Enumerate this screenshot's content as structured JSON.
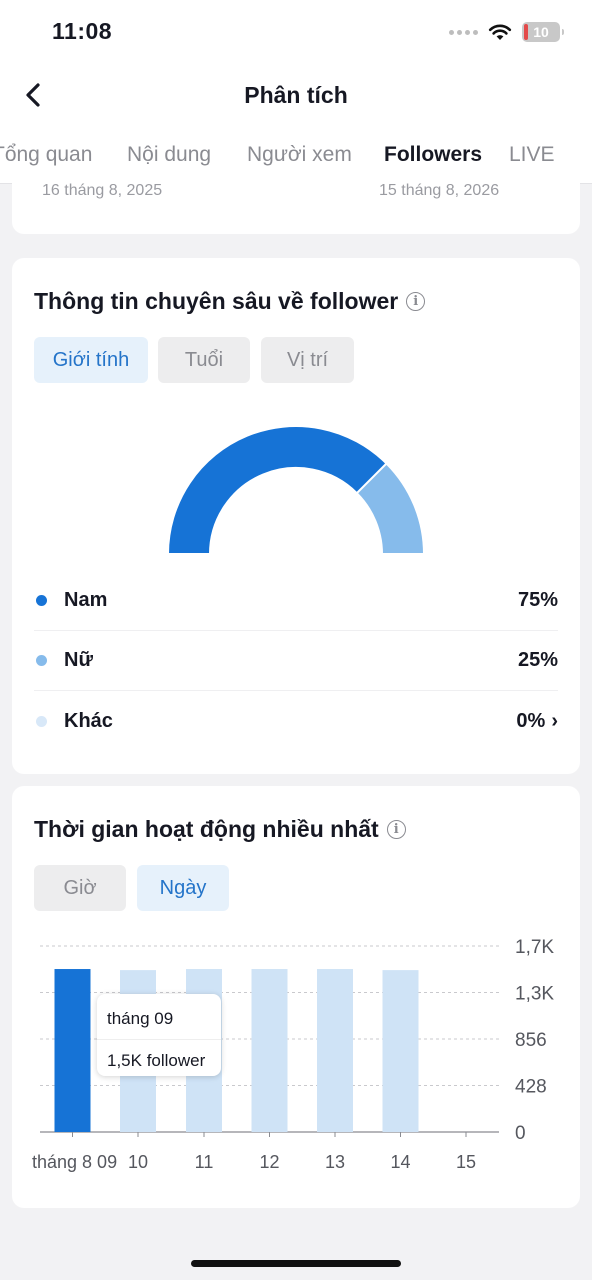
{
  "status_bar": {
    "time": "11:08",
    "battery": "10",
    "icons": [
      "signal-icon",
      "wifi-icon",
      "battery-icon"
    ]
  },
  "nav": {
    "title": "Phân tích",
    "back_icon": "chevron-left-icon"
  },
  "tabs": [
    {
      "label": "Tổng quan",
      "active": false
    },
    {
      "label": "Nội dung",
      "active": false
    },
    {
      "label": "Người xem",
      "active": false
    },
    {
      "label": "Followers",
      "active": true
    },
    {
      "label": "LIVE",
      "active": false
    }
  ],
  "date_range": {
    "start": "16 tháng 8, 2025",
    "end": "15 tháng 8, 2026"
  },
  "insights": {
    "title": "Thông tin chuyên sâu về follower",
    "info_icon": "info-icon",
    "filters": [
      {
        "label": "Giới tính",
        "active": true
      },
      {
        "label": "Tuổi",
        "active": false
      },
      {
        "label": "Vị trí",
        "active": false
      }
    ],
    "gender": [
      {
        "label": "Nam",
        "value": "75%",
        "color": "#1673d6"
      },
      {
        "label": "Nữ",
        "value": "25%",
        "color": "#86bbeb"
      },
      {
        "label": "Khác",
        "value": "0%",
        "color": "#d8e8f8"
      }
    ],
    "more_icon": "chevron-right-icon"
  },
  "activity": {
    "title": "Thời gian hoạt động nhiều nhất",
    "info_icon": "info-icon",
    "filters": [
      {
        "label": "Giờ",
        "active": false
      },
      {
        "label": "Ngày",
        "active": true
      }
    ],
    "tooltip": {
      "month": "tháng 09",
      "value": "1,5K follower"
    }
  },
  "chart_data": {
    "type": "bar",
    "categories": [
      "tháng 8 09",
      "10",
      "11",
      "12",
      "13",
      "14",
      "15"
    ],
    "values": [
      1500,
      1490,
      1500,
      1500,
      1500,
      1490,
      0
    ],
    "highlighted_index": 0,
    "y_ticks": [
      "1,7K",
      "1,3K",
      "856",
      "428",
      "0"
    ],
    "y_tick_values": [
      1712,
      1284,
      856,
      428,
      0
    ],
    "ylim": [
      0,
      1712
    ],
    "grid": true,
    "colors": {
      "highlight": "#1673d6",
      "normal": "#cfe3f6"
    }
  }
}
